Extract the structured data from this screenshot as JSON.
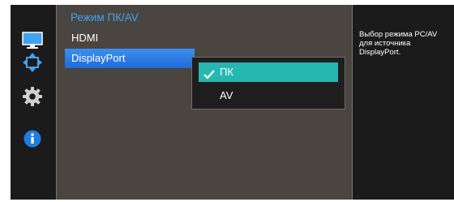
{
  "rail": {
    "icons": [
      {
        "name": "monitor-icon",
        "color": "#3fa3f2"
      },
      {
        "name": "resize-arrows-icon",
        "color": "#3fa3f2"
      },
      {
        "name": "gear-icon",
        "color": "#d0d0d0"
      },
      {
        "name": "info-icon",
        "color": "#1e7fe0"
      }
    ]
  },
  "menu": {
    "title": "Режим ПК/AV",
    "items": [
      {
        "label": "HDMI",
        "selected": false
      },
      {
        "label": "DisplayPort",
        "selected": true
      }
    ]
  },
  "dropdown": {
    "options": [
      {
        "label": "ПК",
        "checked": true
      },
      {
        "label": "AV",
        "checked": false
      }
    ]
  },
  "help": {
    "text": "Выбор режима PC/AV\nдля источника\nDisplayPort."
  },
  "colors": {
    "accent": "#3fa3f2",
    "selection": "#26b8b0",
    "panel": "#4a4540"
  }
}
